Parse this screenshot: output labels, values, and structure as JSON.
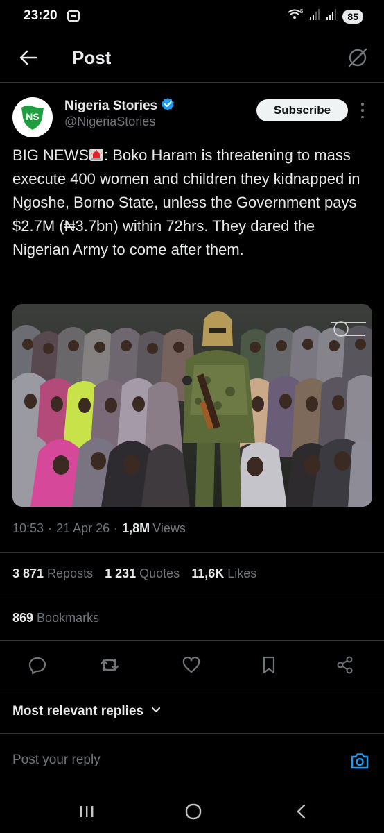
{
  "status": {
    "time": "23:20",
    "battery": "85",
    "network": "5"
  },
  "header": {
    "title": "Post"
  },
  "author": {
    "name": "Nigeria Stories",
    "handle": "@NigeriaStories",
    "avatar_text": "NS",
    "subscribe_label": "Subscribe",
    "verified": true
  },
  "post": {
    "text_part1": "BIG NEWS",
    "text_part2": ": Boko Haram is threatening to mass execute 400 women and children they kidnapped in Ngoshe, Borno State, unless the Government pays $2.7M (₦3.7bn) within 72hrs. They dared the Nigerian Army to come after them."
  },
  "meta": {
    "time": "10:53",
    "date": "21 Apr 26",
    "views": "1,8M",
    "views_label": "Views",
    "sep": "·"
  },
  "stats": {
    "reposts": "3 871",
    "reposts_label": "Reposts",
    "quotes": "1 231",
    "quotes_label": "Quotes",
    "likes": "11,6K",
    "likes_label": "Likes",
    "bookmarks": "869",
    "bookmarks_label": "Bookmarks"
  },
  "replies": {
    "sort_label": "Most relevant replies"
  },
  "reply_bar": {
    "placeholder": "Post your reply"
  },
  "colors": {
    "background": "#000000",
    "text": "#e7e9ea",
    "muted": "#71767b",
    "accent": "#1d9bf0",
    "divider": "#2f3336",
    "brand_green": "#1e9e3e"
  },
  "icons": [
    "back-arrow-icon",
    "grok-icon",
    "verified-badge-icon",
    "more-icon",
    "siren-icon",
    "reply-icon",
    "repost-icon",
    "like-icon",
    "bookmark-icon",
    "share-icon",
    "chevron-down-icon",
    "camera-icon"
  ]
}
